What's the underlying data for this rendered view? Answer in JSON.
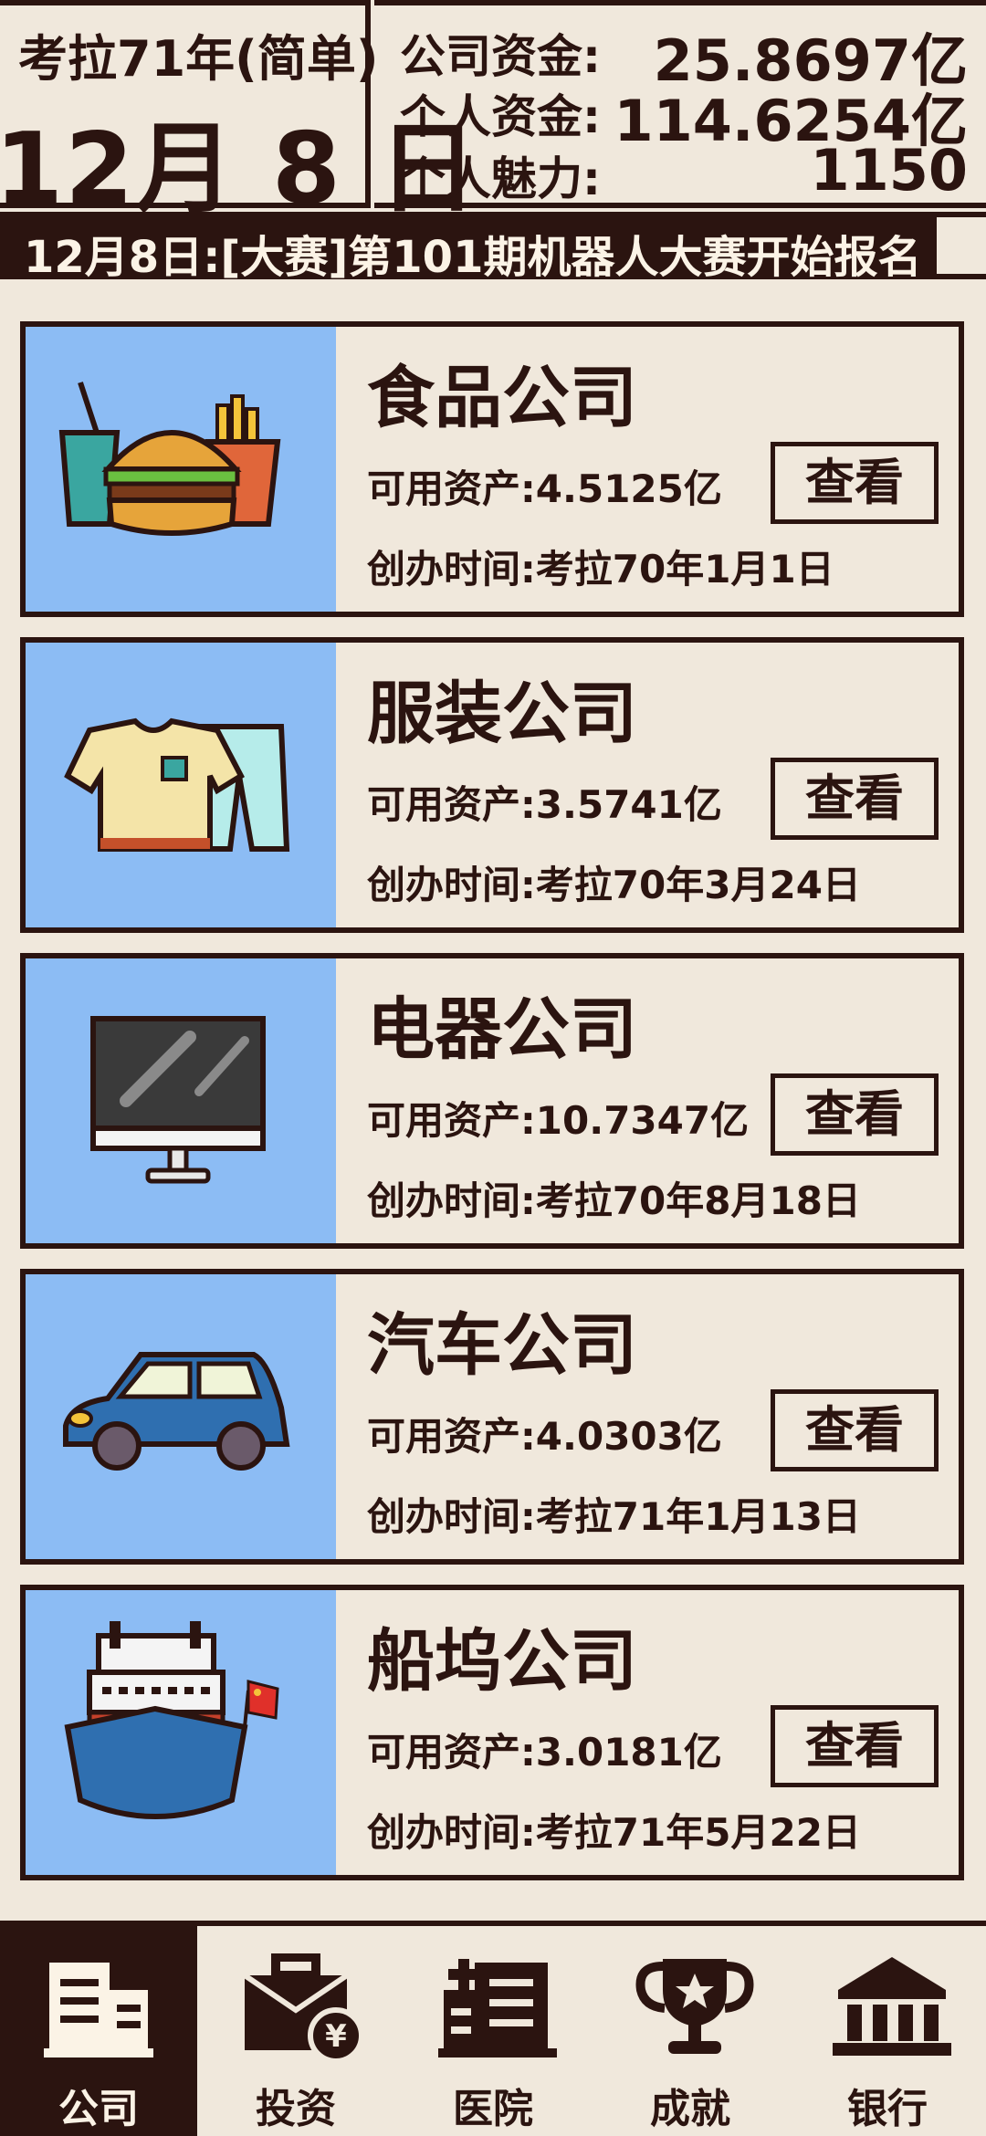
{
  "header": {
    "year_label": "考拉71年(简单)",
    "date_big": "12月 8 日",
    "company_funds_label": "公司资金:",
    "company_funds_value": "25.8697亿",
    "personal_funds_label": "个人资金:",
    "personal_funds_value": "114.6254亿",
    "charm_label": "个人魅力:",
    "charm_value": "1150"
  },
  "ticker": {
    "text": "12月8日:[大赛]第101期机器人大赛开始报名"
  },
  "companies": [
    {
      "name": "食品公司",
      "assets": "可用资产:4.5125亿",
      "founded": "创办时间:考拉70年1月1日",
      "button": "查看",
      "icon": "food-icon"
    },
    {
      "name": "服装公司",
      "assets": "可用资产:3.5741亿",
      "founded": "创办时间:考拉70年3月24日",
      "button": "查看",
      "icon": "clothing-icon"
    },
    {
      "name": "电器公司",
      "assets": "可用资产:10.7347亿",
      "founded": "创办时间:考拉70年8月18日",
      "button": "查看",
      "icon": "monitor-icon"
    },
    {
      "name": "汽车公司",
      "assets": "可用资产:4.0303亿",
      "founded": "创办时间:考拉71年1月13日",
      "button": "查看",
      "icon": "car-icon"
    },
    {
      "name": "船坞公司",
      "assets": "可用资产:3.0181亿",
      "founded": "创办时间:考拉71年5月22日",
      "button": "查看",
      "icon": "ship-icon"
    }
  ],
  "nav": [
    {
      "label": "公司",
      "icon": "building-icon",
      "active": true
    },
    {
      "label": "投资",
      "icon": "briefcase-icon",
      "active": false
    },
    {
      "label": "医院",
      "icon": "hospital-icon",
      "active": false
    },
    {
      "label": "成就",
      "icon": "trophy-icon",
      "active": false
    },
    {
      "label": "银行",
      "icon": "bank-icon",
      "active": false
    }
  ],
  "colors": {
    "background": "#f0e8dc",
    "dark": "#2b1410",
    "thumb_blue": "#8cbcf4"
  }
}
